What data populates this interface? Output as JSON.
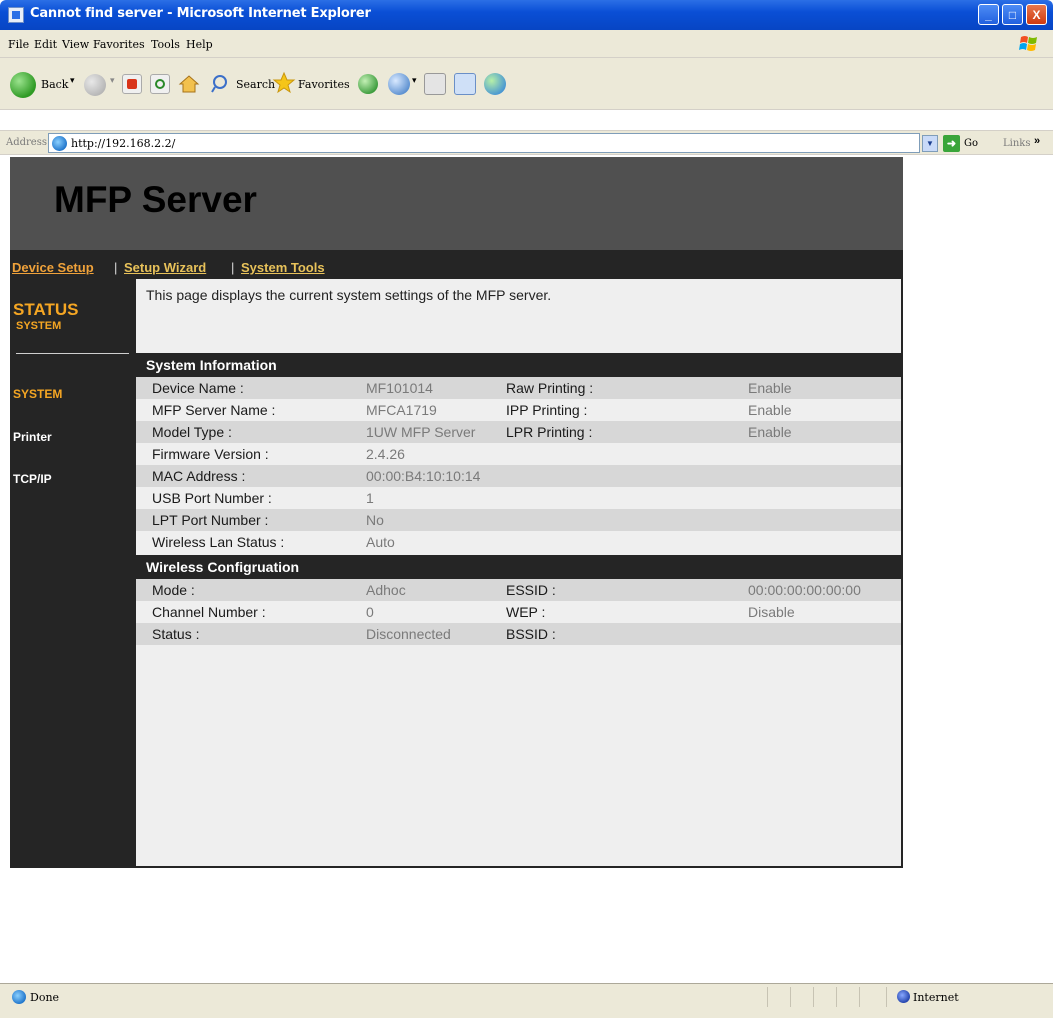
{
  "window": {
    "title": "Cannot find server - Microsoft Internet Explorer",
    "controls": {
      "minimize": "_",
      "maximize": "□",
      "close": "X"
    }
  },
  "menu": {
    "items": [
      "File",
      "Edit",
      "View",
      "Favorites",
      "Tools",
      "Help"
    ]
  },
  "toolbar": {
    "back_label": "Back",
    "search_label": "Search",
    "favorites_label": "Favorites",
    "icons": [
      "back-icon",
      "forward-icon",
      "stop-icon",
      "refresh-icon",
      "home-icon",
      "search-icon",
      "favorites-icon",
      "history-icon",
      "mail-icon",
      "print-icon",
      "edit-icon",
      "messenger-icon"
    ]
  },
  "address": {
    "label": "Address",
    "url": "http://192.168.2.2/",
    "go_label": "Go",
    "links_label": "Links"
  },
  "page": {
    "title": "MFP Server",
    "nav": {
      "device_setup": "Device Setup",
      "setup_wizard": "Setup Wizard",
      "system_tools": "System Tools",
      "separator": "|"
    },
    "sidebar": {
      "status": "STATUS",
      "status_sub": "SYSTEM",
      "items": [
        "SYSTEM",
        "Printer",
        "TCP/IP"
      ]
    },
    "intro": "This page displays the current system settings of the MFP server.",
    "system_info": {
      "heading": "System Information",
      "rows": [
        {
          "label": "Device Name :",
          "value": "MF101014",
          "label2": "Raw Printing :",
          "value2": "Enable"
        },
        {
          "label": "MFP Server Name :",
          "value": "MFCA1719",
          "label2": "IPP Printing :",
          "value2": "Enable"
        },
        {
          "label": "Model Type :",
          "value": "1UW MFP Server",
          "label2": "LPR Printing :",
          "value2": "Enable"
        },
        {
          "label": "Firmware Version :",
          "value": "2.4.26",
          "label2": "",
          "value2": ""
        },
        {
          "label": "MAC Address :",
          "value": "00:00:B4:10:10:14",
          "label2": "",
          "value2": ""
        },
        {
          "label": "USB Port Number :",
          "value": "1",
          "label2": "",
          "value2": ""
        },
        {
          "label": "LPT Port Number :",
          "value": "No",
          "label2": "",
          "value2": ""
        },
        {
          "label": "Wireless Lan Status :",
          "value": "Auto",
          "label2": "",
          "value2": ""
        }
      ]
    },
    "wireless_config": {
      "heading": "Wireless Configruation",
      "rows": [
        {
          "label": "Mode :",
          "value": "Adhoc",
          "label2": "ESSID :",
          "value2": "00:00:00:00:00:00"
        },
        {
          "label": "Channel Number :",
          "value": "0",
          "label2": "WEP :",
          "value2": "Disable"
        },
        {
          "label": "Status :",
          "value": "Disconnected",
          "label2": "BSSID :",
          "value2": ""
        }
      ]
    }
  },
  "statusbar": {
    "text": "Done",
    "zone": "Internet"
  },
  "colors": {
    "accent_orange": "#f5a623",
    "nav_link_gold": "#e8c25a",
    "dark_band": "#252525",
    "header_gray": "#505050"
  }
}
